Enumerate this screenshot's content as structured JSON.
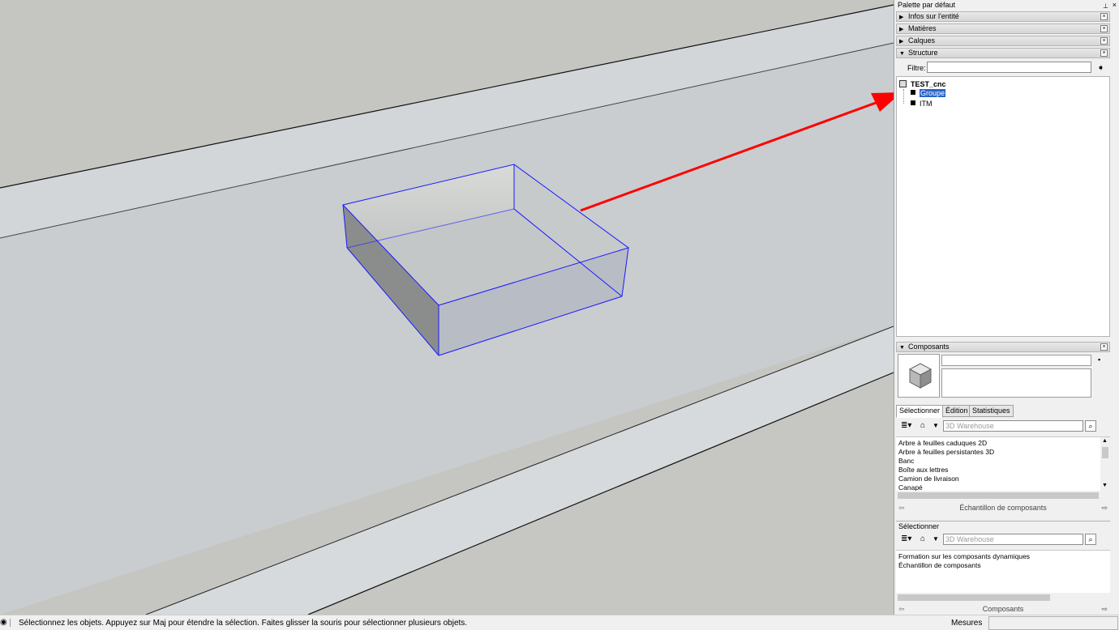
{
  "palette": {
    "title": "Palette par défaut",
    "pin_glyph": "⊥",
    "close_glyph": "×"
  },
  "trays": [
    {
      "label": "Infos sur l'entité",
      "expanded": false
    },
    {
      "label": "Matières",
      "expanded": false
    },
    {
      "label": "Calques",
      "expanded": false
    },
    {
      "label": "Structure",
      "expanded": true
    }
  ],
  "structure": {
    "filter_label": "Filtre:",
    "filter_value": "",
    "root": "TEST_cnc",
    "items": [
      {
        "label": "Groupe",
        "selected": true
      },
      {
        "label": "ITM",
        "selected": false
      }
    ]
  },
  "components": {
    "title": "Composants",
    "tabs": [
      "Sélectionner",
      "Édition",
      "Statistiques"
    ],
    "search_placeholder": "3D Warehouse",
    "list": [
      "Arbre à feuilles caduques 2D",
      "Arbre à feuilles persistantes 3D",
      "Banc",
      "Boîte aux lettres",
      "Camion de livraison",
      "Canapé"
    ],
    "nav_label": "Échantillon de composants",
    "second_section": "Sélectionner",
    "second_search_placeholder": "3D Warehouse",
    "second_list": [
      "Formation sur les composants dynamiques",
      "Échantillon de composants"
    ],
    "bottom_nav_label": "Composants"
  },
  "status": {
    "message": "Sélectionnez les objets. Appuyez sur Maj pour étendre la sélection. Faites glisser la souris pour sélectionner plusieurs objets.",
    "measure_label": "Mesures",
    "measure_value": ""
  },
  "colors": {
    "viewport_bg": "#c5c6c1",
    "selection_edge": "#1a1aff",
    "annotation_arrow": "#ff0000",
    "tree_selected": "#2a64c8"
  },
  "icons": {
    "collapsed_tray": "triangle-right-icon",
    "expanded_tray": "triangle-down-icon",
    "model_root": "model-icon",
    "group": "group-icon",
    "component_box": "component-box-icon",
    "home": "home-icon",
    "search": "search-icon",
    "details": "details-icon",
    "filter_go": "arrow-right-icon"
  }
}
